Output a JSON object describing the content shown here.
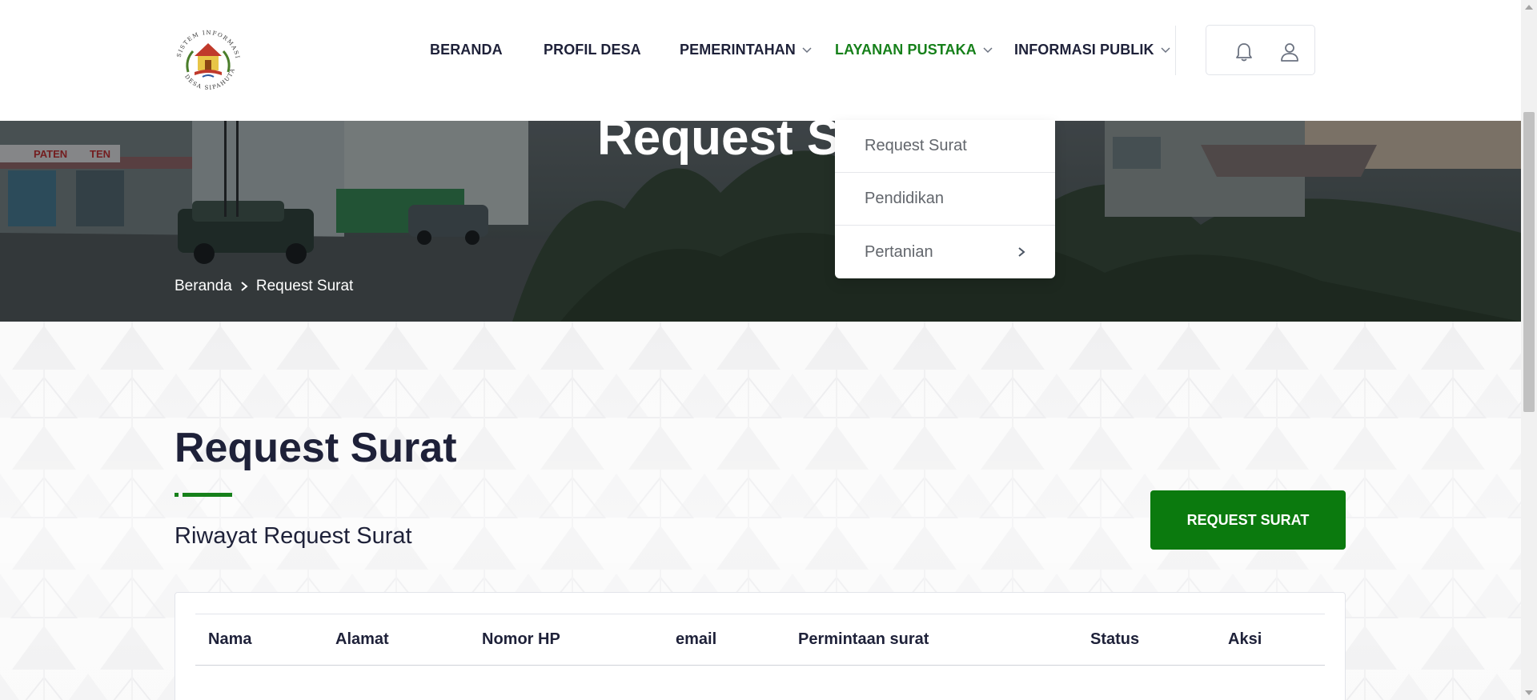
{
  "brand": {
    "logo_ring_text": "SISTEM INFORMASI DESA SIPAHUTAR"
  },
  "nav": {
    "items": [
      {
        "label": "BERANDA",
        "has_chevron": false
      },
      {
        "label": "PROFIL DESA",
        "has_chevron": false
      },
      {
        "label": "PEMERINTAHAN",
        "has_chevron": true
      },
      {
        "label": "LAYANAN PUSTAKA",
        "has_chevron": true,
        "active": true
      },
      {
        "label": "INFORMASI PUBLIK",
        "has_chevron": true
      }
    ],
    "icons": [
      "bell-icon",
      "user-icon"
    ]
  },
  "hero": {
    "title": "Request Surat",
    "breadcrumb": [
      "Beranda",
      "Request Surat"
    ],
    "sign_text": "PATEN",
    "sign_short": "TEN"
  },
  "dropdown": {
    "items": [
      {
        "label": "Request Surat"
      },
      {
        "label": "Pendidikan"
      },
      {
        "label": "Pertanian",
        "has_submenu": true
      }
    ]
  },
  "main": {
    "title": "Request Surat",
    "subtitle": "Riwayat Request Surat",
    "button_label": "REQUEST SURAT",
    "table_headers": [
      "Nama",
      "Alamat",
      "Nomor HP",
      "email",
      "Permintaan surat",
      "Status",
      "Aksi"
    ]
  },
  "colors": {
    "accent_green": "#16801a",
    "button_green": "#0b7a0e",
    "text_dark": "#1e2139"
  }
}
